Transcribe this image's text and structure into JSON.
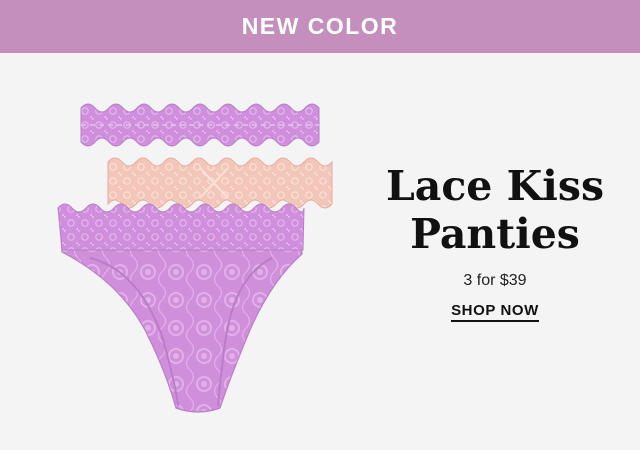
{
  "banner": {
    "text": "NEW COLOR"
  },
  "promo": {
    "headline_line1": "Lace Kiss",
    "headline_line2": "Panties",
    "price": "3 for $39",
    "cta": "SHOP NOW"
  },
  "colors": {
    "banner": "#c48fbd",
    "background": "#f4f4f4",
    "lilac": "#cf8fdc",
    "lilac_dark": "#b97dc8",
    "blush": "#f2c6b8"
  },
  "product_image": {
    "items": [
      "lilac-lace-band",
      "blush-lace-band",
      "lilac-lace-brief"
    ]
  }
}
